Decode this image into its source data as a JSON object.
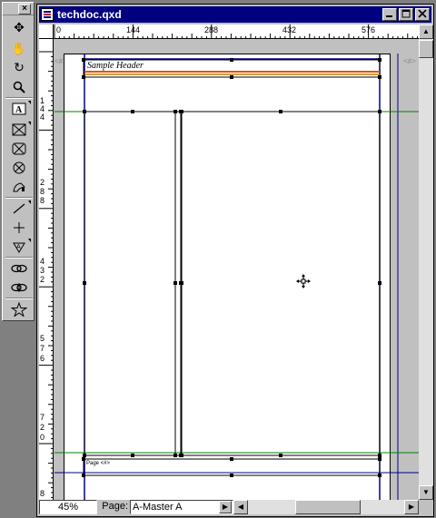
{
  "window": {
    "title": "techdoc.qxd"
  },
  "palette": {
    "close_label": "×",
    "tools": [
      {
        "name": "item-tool",
        "glyph": "✥"
      },
      {
        "name": "content-tool",
        "glyph": "☚"
      },
      {
        "name": "rotation-tool",
        "glyph": "↻"
      },
      {
        "name": "zoom-tool",
        "glyph": "🔍"
      },
      {
        "name": "text-box-tool",
        "glyph": "A"
      },
      {
        "name": "picture-box-tool",
        "glyph": "⊠"
      },
      {
        "name": "picture-box-oval-tool",
        "glyph": "⊠"
      },
      {
        "name": "picture-box-circle-tool",
        "glyph": "⊗"
      },
      {
        "name": "bezier-picture-tool",
        "glyph": "⬭"
      },
      {
        "name": "line-tool",
        "glyph": "／"
      },
      {
        "name": "orthogonal-line-tool",
        "glyph": "+"
      },
      {
        "name": "text-path-tool",
        "glyph": "⊿"
      },
      {
        "name": "linking-tool",
        "glyph": "∞"
      },
      {
        "name": "unlinking-tool",
        "glyph": "∞"
      },
      {
        "name": "star-tool",
        "glyph": "☆"
      }
    ]
  },
  "rulers": {
    "horizontal": [
      "0",
      "144",
      "288",
      "432",
      "576"
    ],
    "vertical": [
      "1 4 4",
      "2 8 8",
      "4 3 2",
      "5 7 6",
      "7 2 0",
      "8"
    ]
  },
  "page": {
    "header_text": "Sample Header",
    "footer_text": "Page <#>",
    "pasteboard_marks": [
      "<#>",
      "<#>"
    ]
  },
  "status": {
    "zoom": "45%",
    "page_label": "Page:",
    "page_value": "A-Master A"
  }
}
